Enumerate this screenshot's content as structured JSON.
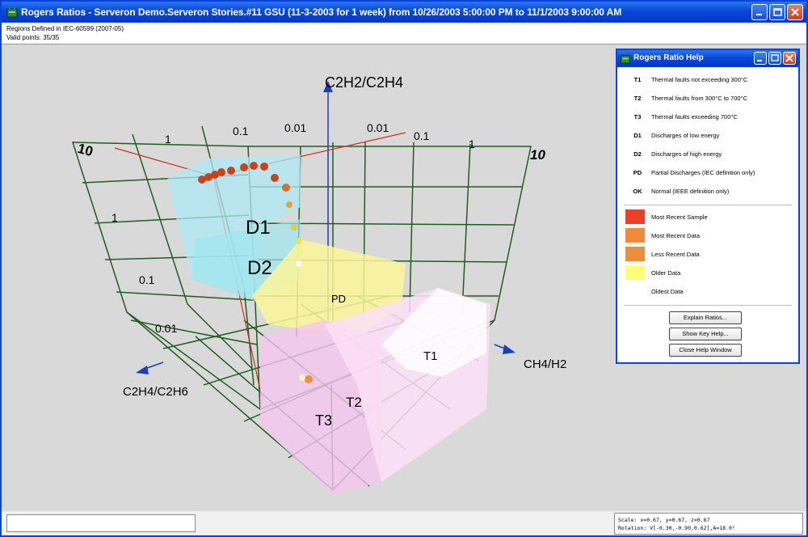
{
  "window": {
    "title": "Rogers Ratios - Serveron Demo.Serveron Stories.#11 GSU (11-3-2003 for 1 week) from 10/26/2003 5:00:00 PM to 11/1/2003 9:00:00 AM"
  },
  "info": {
    "regions": "Regions Defined in IEC-60599 (2007-05)",
    "valid_points": "Valid points: 35/35"
  },
  "plot": {
    "axes": {
      "vertical": "C2H2/C2H4",
      "right": "CH4/H2",
      "left": "C2H4/C2H6"
    },
    "back_ticks": [
      "10",
      "1",
      "0.1",
      "0.01",
      "0.01",
      "0.1",
      "1",
      "10"
    ],
    "left_ticks": [
      "1",
      "0.1",
      "0.01"
    ],
    "regions": [
      "D1",
      "D2",
      "PD",
      "T1",
      "T2",
      "T3"
    ]
  },
  "help": {
    "title": "Rogers Ratio Help",
    "rows": [
      {
        "code": "T1",
        "desc": "Thermal faults not exceeding 300°C"
      },
      {
        "code": "T2",
        "desc": "Thermal faults from 300°C to 700°C"
      },
      {
        "code": "T3",
        "desc": "Thermal faults exceeding 700°C"
      },
      {
        "code": "D1",
        "desc": "Discharges of low energy"
      },
      {
        "code": "D2",
        "desc": "Discharges of high energy"
      },
      {
        "code": "PD",
        "desc": "Partial Discharges (IEC definition only)"
      },
      {
        "code": "OK",
        "desc": "Normal (IEEE definition only)"
      }
    ],
    "legend": [
      {
        "label": "Most Recent Sample",
        "color": "#e8402a"
      },
      {
        "label": "Most Recent Data",
        "color": "#f08a3c"
      },
      {
        "label": "Less Recent Data",
        "color": "#e8903a"
      },
      {
        "label": "Older Data",
        "color": "#ffff7a"
      },
      {
        "label": "Oldest Data",
        "color": "#ffffff"
      }
    ],
    "buttons": {
      "explain": "Explain Ratios...",
      "key": "Show Key Help...",
      "close": "Close Help Window"
    }
  },
  "status": {
    "readout_scale": "Scale: x=0.67, y=0.67, z=0.67",
    "readout_rotation": "Rotation: V[-0.30,-0.90,0.62],A=18.0°"
  }
}
